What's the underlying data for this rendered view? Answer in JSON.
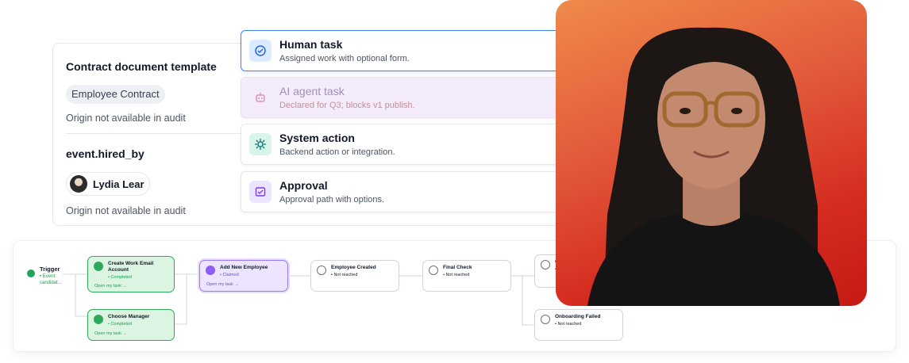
{
  "audit": {
    "contract_heading": "Contract document template",
    "contract_chip": "Employee Contract",
    "origin_text_1": "Origin not available in audit",
    "event_heading": "event.hired_by",
    "person_name": "Lydia Lear",
    "origin_text_2": "Origin not available in audit"
  },
  "task_menu": [
    {
      "title": "Human task",
      "desc": "Assigned work with optional form.",
      "icon": "human-task-icon"
    },
    {
      "title": "AI agent task",
      "desc": "Declared for Q3; blocks v1 publish.",
      "icon": "robot-icon"
    },
    {
      "title": "System action",
      "desc": "Backend action or integration.",
      "icon": "gear-icon"
    },
    {
      "title": "Approval",
      "desc": "Approval path with options.",
      "icon": "approval-icon"
    }
  ],
  "flow": {
    "trigger": {
      "label": "Trigger",
      "sub": "• Event: candidat..."
    },
    "nodes": [
      {
        "title": "Create Work Email Account",
        "status": "• Completed",
        "link": "Open my task →"
      },
      {
        "title": "Choose Manager",
        "status": "• Completed",
        "link": "Open my task →"
      },
      {
        "title": "Add New Employee",
        "status": "• Claimed",
        "link": "Open my task →"
      },
      {
        "title": "Employee Created",
        "status": "• Not reached"
      },
      {
        "title": "Final Check",
        "status": "• Not reached"
      },
      {
        "title": "O",
        "status": "•"
      },
      {
        "title": "Onboarding Failed",
        "status": "• Not reached"
      }
    ]
  },
  "colors": {
    "accent_blue": "#3b82f6",
    "success_green": "#2ea85a",
    "claimed_purple": "#9b7bf0",
    "photo_gradient_start": "#f08a4b",
    "photo_gradient_end": "#c61a14"
  }
}
